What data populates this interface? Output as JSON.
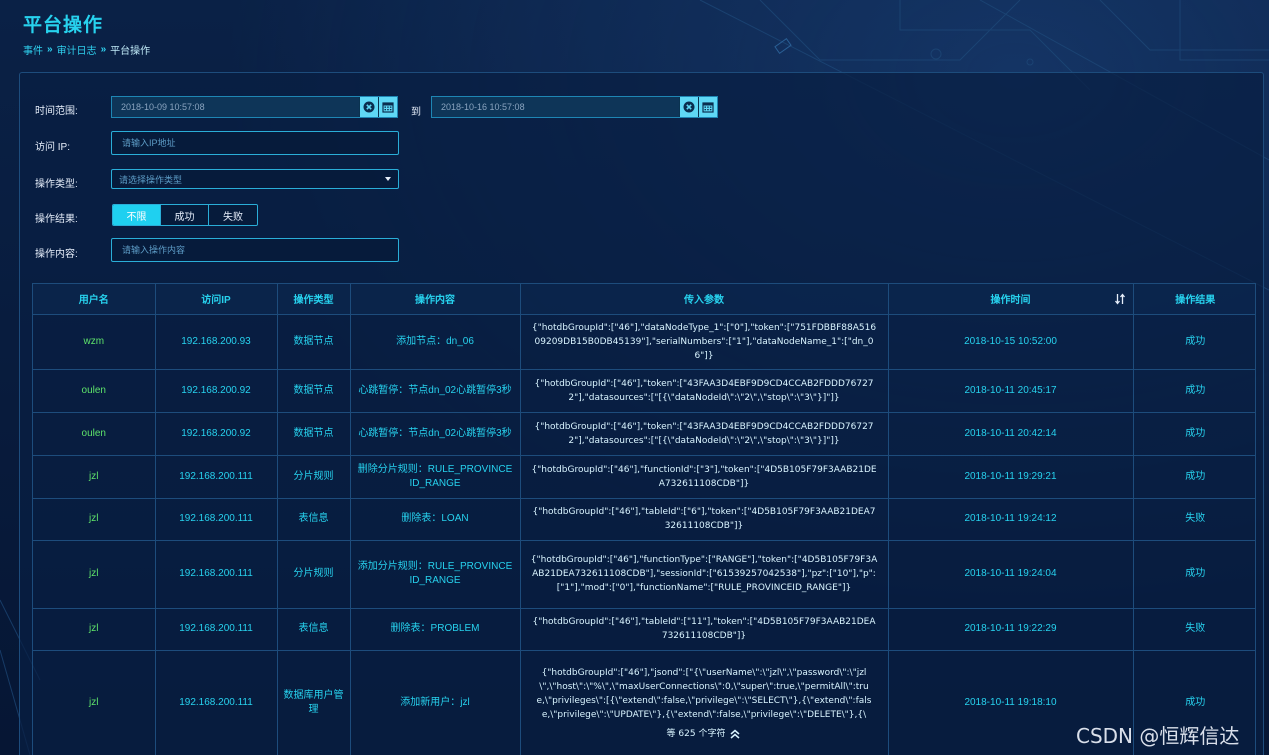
{
  "page": {
    "title": "平台操作",
    "breadcrumb": [
      "事件",
      "审计日志",
      "平台操作"
    ],
    "watermark": "CSDN @恒辉信达"
  },
  "filters": {
    "time_range_label": "时间范围:",
    "start_date": "2018-10-09 10:57:08",
    "to_label": "到",
    "end_date": "2018-10-16 10:57:08",
    "ip_label": "访问  IP:",
    "ip_placeholder": "请输入IP地址",
    "op_type_label": "操作类型:",
    "op_type_placeholder": "请选择操作类型",
    "result_label": "操作结果:",
    "result_options": [
      "不限",
      "成功",
      "失败"
    ],
    "result_selected": "不限",
    "content_label": "操作内容:",
    "content_placeholder": "请输入操作内容"
  },
  "table": {
    "columns": [
      "用户名",
      "访问IP",
      "操作类型",
      "操作内容",
      "传入参数",
      "操作时间",
      "操作结果"
    ],
    "rows": [
      {
        "user": "wzm",
        "ip": "192.168.200.93",
        "type": "数据节点",
        "content": "添加节点：dn_06",
        "params": "{\"hotdbGroupId\":[\"46\"],\"dataNodeType_1\":[\"0\"],\"token\":[\"751FDBBF88A51609209DB15B0DB45139\"],\"serialNumbers\":[\"1\"],\"dataNodeName_1\":[\"dn_06\"]}",
        "time": "2018-10-15 10:52:00",
        "result": "成功"
      },
      {
        "user": "oulen",
        "ip": "192.168.200.92",
        "type": "数据节点",
        "content": "心跳暂停：节点dn_02心跳暂停3秒",
        "params": "{\"hotdbGroupId\":[\"46\"],\"token\":[\"43FAA3D4EBF9D9CD4CCAB2FDDD767272\"],\"datasources\":[\"[{\\\"dataNodeId\\\":\\\"2\\\",\\\"stop\\\":\\\"3\\\"}]\"]}",
        "time": "2018-10-11 20:45:17",
        "result": "成功"
      },
      {
        "user": "oulen",
        "ip": "192.168.200.92",
        "type": "数据节点",
        "content": "心跳暂停：节点dn_02心跳暂停3秒",
        "params": "{\"hotdbGroupId\":[\"46\"],\"token\":[\"43FAA3D4EBF9D9CD4CCAB2FDDD767272\"],\"datasources\":[\"[{\\\"dataNodeId\\\":\\\"2\\\",\\\"stop\\\":\\\"3\\\"}]\"]}",
        "time": "2018-10-11 20:42:14",
        "result": "成功"
      },
      {
        "user": "jzl",
        "ip": "192.168.200.111",
        "type": "分片规则",
        "content": "删除分片规则：RULE_PROVINCEID_RANGE",
        "params": "{\"hotdbGroupId\":[\"46\"],\"functionId\":[\"3\"],\"token\":[\"4D5B105F79F3AAB21DEA732611108CDB\"]}",
        "time": "2018-10-11 19:29:21",
        "result": "成功"
      },
      {
        "user": "jzl",
        "ip": "192.168.200.111",
        "type": "表信息",
        "content": "删除表：LOAN",
        "params": "{\"hotdbGroupId\":[\"46\"],\"tableId\":[\"6\"],\"token\":[\"4D5B105F79F3AAB21DEA732611108CDB\"]}",
        "time": "2018-10-11 19:24:12",
        "result": "失败"
      },
      {
        "user": "jzl",
        "ip": "192.168.200.111",
        "type": "分片规则",
        "content": "添加分片规则：RULE_PROVINCEID_RANGE",
        "params": "{\"hotdbGroupId\":[\"46\"],\"functionType\":[\"RANGE\"],\"token\":[\"4D5B105F79F3AAB21DEA732611108CDB\"],\"sessionId\":[\"61539257042538\"],\"pz\":[\"10\"],\"p\":[\"1\"],\"mod\":[\"0\"],\"functionName\":[\"RULE_PROVINCEID_RANGE\"]}",
        "time": "2018-10-11 19:24:04",
        "result": "成功"
      },
      {
        "user": "jzl",
        "ip": "192.168.200.111",
        "type": "表信息",
        "content": "删除表：PROBLEM",
        "params": "{\"hotdbGroupId\":[\"46\"],\"tableId\":[\"11\"],\"token\":[\"4D5B105F79F3AAB21DEA732611108CDB\"]}",
        "time": "2018-10-11 19:22:29",
        "result": "失败"
      },
      {
        "user": "jzl",
        "ip": "192.168.200.111",
        "type": "数据库用户管理",
        "content": "添加新用户：jzl",
        "params": "{\"hotdbGroupId\":[\"46\"],\"jsond\":[\"{\\\"userName\\\":\\\"jzl\\\",\\\"password\\\":\\\"jzl\\\",\\\"host\\\":\\\"%\\\",\\\"maxUserConnections\\\":0,\\\"super\\\":true,\\\"permitAll\\\":true,\\\"privileges\\\":[{\\\"extend\\\":false,\\\"privilege\\\":\\\"SELECT\\\"},{\\\"extend\\\":false,\\\"privilege\\\":\\\"UPDATE\\\"},{\\\"extend\\\":false,\\\"privilege\\\":\\\"DELETE\\\"},{\\",
        "params_more": "等 625 个字符",
        "time": "2018-10-11 19:18:10",
        "result": "成功"
      }
    ]
  },
  "colors": {
    "accent": "#27d2ee",
    "user_green": "#5ee36a",
    "background": "#071a3a"
  }
}
